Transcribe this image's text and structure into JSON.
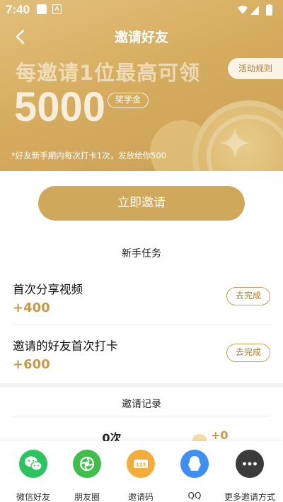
{
  "status_bar": {
    "time": "7:40",
    "a_icon": "A"
  },
  "header": {
    "title": "邀请好友",
    "headline": "每邀请1位最高可领",
    "rules_label": "活动规则",
    "amount": "5000",
    "amount_unit": "奖学金",
    "footnote": "*好友新手期内每次打卡1次，发放给你500"
  },
  "invite_button": "立即邀请",
  "tasks_section": {
    "title": "新手任务",
    "items": [
      {
        "name": "首次分享视频",
        "reward": "+400",
        "action": "去完成"
      },
      {
        "name": "邀请的好友首次打卡",
        "reward": "+600",
        "action": "去完成"
      }
    ]
  },
  "records": {
    "title": "邀请记录",
    "count": "0次",
    "amount": "+0"
  },
  "share_bar": {
    "items": [
      {
        "label": "微信好友",
        "icon": "wechat-icon",
        "color": "#2bc45f"
      },
      {
        "label": "朋友圈",
        "icon": "moments-icon",
        "color": "#3fbe4a"
      },
      {
        "label": "邀请码",
        "icon": "invite-code-icon",
        "color": "#f3ad3c"
      },
      {
        "label": "QQ",
        "icon": "qq-icon",
        "color": "#3d8ff3"
      },
      {
        "label": "更多邀请方式",
        "icon": "more-icon",
        "color": "#3b3b3b"
      }
    ]
  },
  "colors": {
    "gold": "#cfa85c",
    "gold_text": "#c69a4b"
  }
}
